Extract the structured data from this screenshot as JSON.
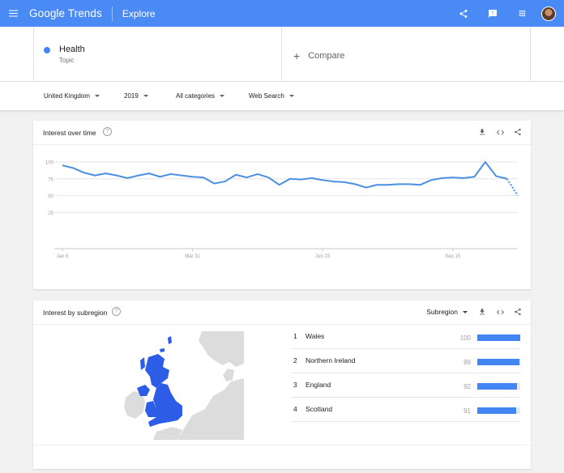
{
  "header": {
    "logo_google": "Google",
    "logo_trends": "Trends",
    "section": "Explore",
    "brand_color": "#4a8af4",
    "icons": [
      "menu-icon",
      "share-icon",
      "feedback-icon",
      "apps-icon",
      "avatar"
    ]
  },
  "terms": {
    "term1": {
      "name": "Health",
      "type": "Topic",
      "color": "#4285f4"
    },
    "compare_label": "Compare"
  },
  "filters": {
    "region": "United Kingdom",
    "time": "2019",
    "category": "All categories",
    "property": "Web Search"
  },
  "interest_over_time": {
    "title": "Interest over time",
    "help_icon": "help-icon",
    "tools": [
      "download-icon",
      "embed-icon",
      "share-icon"
    ],
    "chart_data": {
      "type": "line",
      "ylim": [
        0,
        100
      ],
      "y_ticks": [
        25,
        50,
        75,
        100
      ],
      "x_tick_labels": [
        "Jan 6",
        "Mar 31",
        "Jun 23",
        "Sep 15"
      ],
      "x_tick_index": [
        0,
        12,
        24,
        36
      ],
      "series": [
        {
          "color": "#4a90e2",
          "values": [
            95,
            91,
            84,
            80,
            83,
            80,
            76,
            80,
            83,
            78,
            82,
            80,
            78,
            77,
            68,
            71,
            81,
            77,
            82,
            77,
            66,
            75,
            74,
            76,
            73,
            71,
            70,
            67,
            62,
            66,
            66,
            67,
            67,
            66,
            73,
            76,
            77,
            76,
            78,
            100,
            79,
            75
          ],
          "partial_tail": [
            75,
            50
          ]
        }
      ],
      "grid": true
    }
  },
  "interest_by_subregion": {
    "title": "Interest by subregion",
    "help_icon": "help-icon",
    "resolution_label": "Subregion",
    "tools": [
      "download-icon",
      "embed-icon",
      "share-icon"
    ],
    "map_color": "#2d5de6",
    "regions": [
      {
        "rank": "1",
        "name": "Wales",
        "value": "100",
        "fraction": 1.0
      },
      {
        "rank": "2",
        "name": "Northern Ireland",
        "value": "99",
        "fraction": 0.99
      },
      {
        "rank": "3",
        "name": "England",
        "value": "92",
        "fraction": 0.92
      },
      {
        "rank": "4",
        "name": "Scotland",
        "value": "91",
        "fraction": 0.91
      }
    ]
  }
}
